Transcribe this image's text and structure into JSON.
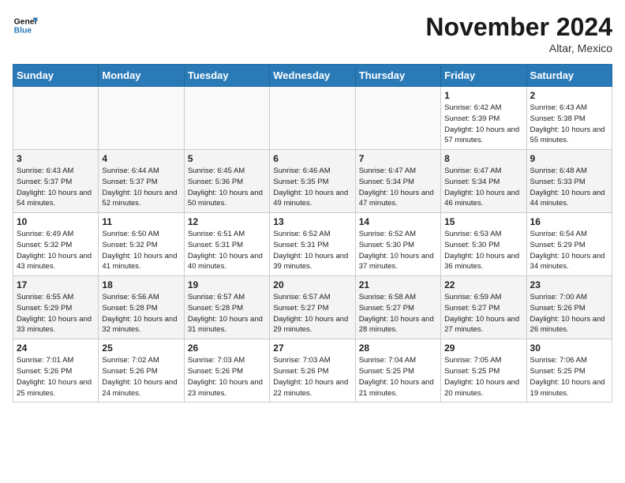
{
  "header": {
    "logo_line1": "General",
    "logo_line2": "Blue",
    "month_year": "November 2024",
    "location": "Altar, Mexico"
  },
  "weekdays": [
    "Sunday",
    "Monday",
    "Tuesday",
    "Wednesday",
    "Thursday",
    "Friday",
    "Saturday"
  ],
  "weeks": [
    [
      {
        "day": "",
        "info": ""
      },
      {
        "day": "",
        "info": ""
      },
      {
        "day": "",
        "info": ""
      },
      {
        "day": "",
        "info": ""
      },
      {
        "day": "",
        "info": ""
      },
      {
        "day": "1",
        "info": "Sunrise: 6:42 AM\nSunset: 5:39 PM\nDaylight: 10 hours and 57 minutes."
      },
      {
        "day": "2",
        "info": "Sunrise: 6:43 AM\nSunset: 5:38 PM\nDaylight: 10 hours and 55 minutes."
      }
    ],
    [
      {
        "day": "3",
        "info": "Sunrise: 6:43 AM\nSunset: 5:37 PM\nDaylight: 10 hours and 54 minutes."
      },
      {
        "day": "4",
        "info": "Sunrise: 6:44 AM\nSunset: 5:37 PM\nDaylight: 10 hours and 52 minutes."
      },
      {
        "day": "5",
        "info": "Sunrise: 6:45 AM\nSunset: 5:36 PM\nDaylight: 10 hours and 50 minutes."
      },
      {
        "day": "6",
        "info": "Sunrise: 6:46 AM\nSunset: 5:35 PM\nDaylight: 10 hours and 49 minutes."
      },
      {
        "day": "7",
        "info": "Sunrise: 6:47 AM\nSunset: 5:34 PM\nDaylight: 10 hours and 47 minutes."
      },
      {
        "day": "8",
        "info": "Sunrise: 6:47 AM\nSunset: 5:34 PM\nDaylight: 10 hours and 46 minutes."
      },
      {
        "day": "9",
        "info": "Sunrise: 6:48 AM\nSunset: 5:33 PM\nDaylight: 10 hours and 44 minutes."
      }
    ],
    [
      {
        "day": "10",
        "info": "Sunrise: 6:49 AM\nSunset: 5:32 PM\nDaylight: 10 hours and 43 minutes."
      },
      {
        "day": "11",
        "info": "Sunrise: 6:50 AM\nSunset: 5:32 PM\nDaylight: 10 hours and 41 minutes."
      },
      {
        "day": "12",
        "info": "Sunrise: 6:51 AM\nSunset: 5:31 PM\nDaylight: 10 hours and 40 minutes."
      },
      {
        "day": "13",
        "info": "Sunrise: 6:52 AM\nSunset: 5:31 PM\nDaylight: 10 hours and 39 minutes."
      },
      {
        "day": "14",
        "info": "Sunrise: 6:52 AM\nSunset: 5:30 PM\nDaylight: 10 hours and 37 minutes."
      },
      {
        "day": "15",
        "info": "Sunrise: 6:53 AM\nSunset: 5:30 PM\nDaylight: 10 hours and 36 minutes."
      },
      {
        "day": "16",
        "info": "Sunrise: 6:54 AM\nSunset: 5:29 PM\nDaylight: 10 hours and 34 minutes."
      }
    ],
    [
      {
        "day": "17",
        "info": "Sunrise: 6:55 AM\nSunset: 5:29 PM\nDaylight: 10 hours and 33 minutes."
      },
      {
        "day": "18",
        "info": "Sunrise: 6:56 AM\nSunset: 5:28 PM\nDaylight: 10 hours and 32 minutes."
      },
      {
        "day": "19",
        "info": "Sunrise: 6:57 AM\nSunset: 5:28 PM\nDaylight: 10 hours and 31 minutes."
      },
      {
        "day": "20",
        "info": "Sunrise: 6:57 AM\nSunset: 5:27 PM\nDaylight: 10 hours and 29 minutes."
      },
      {
        "day": "21",
        "info": "Sunrise: 6:58 AM\nSunset: 5:27 PM\nDaylight: 10 hours and 28 minutes."
      },
      {
        "day": "22",
        "info": "Sunrise: 6:59 AM\nSunset: 5:27 PM\nDaylight: 10 hours and 27 minutes."
      },
      {
        "day": "23",
        "info": "Sunrise: 7:00 AM\nSunset: 5:26 PM\nDaylight: 10 hours and 26 minutes."
      }
    ],
    [
      {
        "day": "24",
        "info": "Sunrise: 7:01 AM\nSunset: 5:26 PM\nDaylight: 10 hours and 25 minutes."
      },
      {
        "day": "25",
        "info": "Sunrise: 7:02 AM\nSunset: 5:26 PM\nDaylight: 10 hours and 24 minutes."
      },
      {
        "day": "26",
        "info": "Sunrise: 7:03 AM\nSunset: 5:26 PM\nDaylight: 10 hours and 23 minutes."
      },
      {
        "day": "27",
        "info": "Sunrise: 7:03 AM\nSunset: 5:26 PM\nDaylight: 10 hours and 22 minutes."
      },
      {
        "day": "28",
        "info": "Sunrise: 7:04 AM\nSunset: 5:25 PM\nDaylight: 10 hours and 21 minutes."
      },
      {
        "day": "29",
        "info": "Sunrise: 7:05 AM\nSunset: 5:25 PM\nDaylight: 10 hours and 20 minutes."
      },
      {
        "day": "30",
        "info": "Sunrise: 7:06 AM\nSunset: 5:25 PM\nDaylight: 10 hours and 19 minutes."
      }
    ]
  ]
}
